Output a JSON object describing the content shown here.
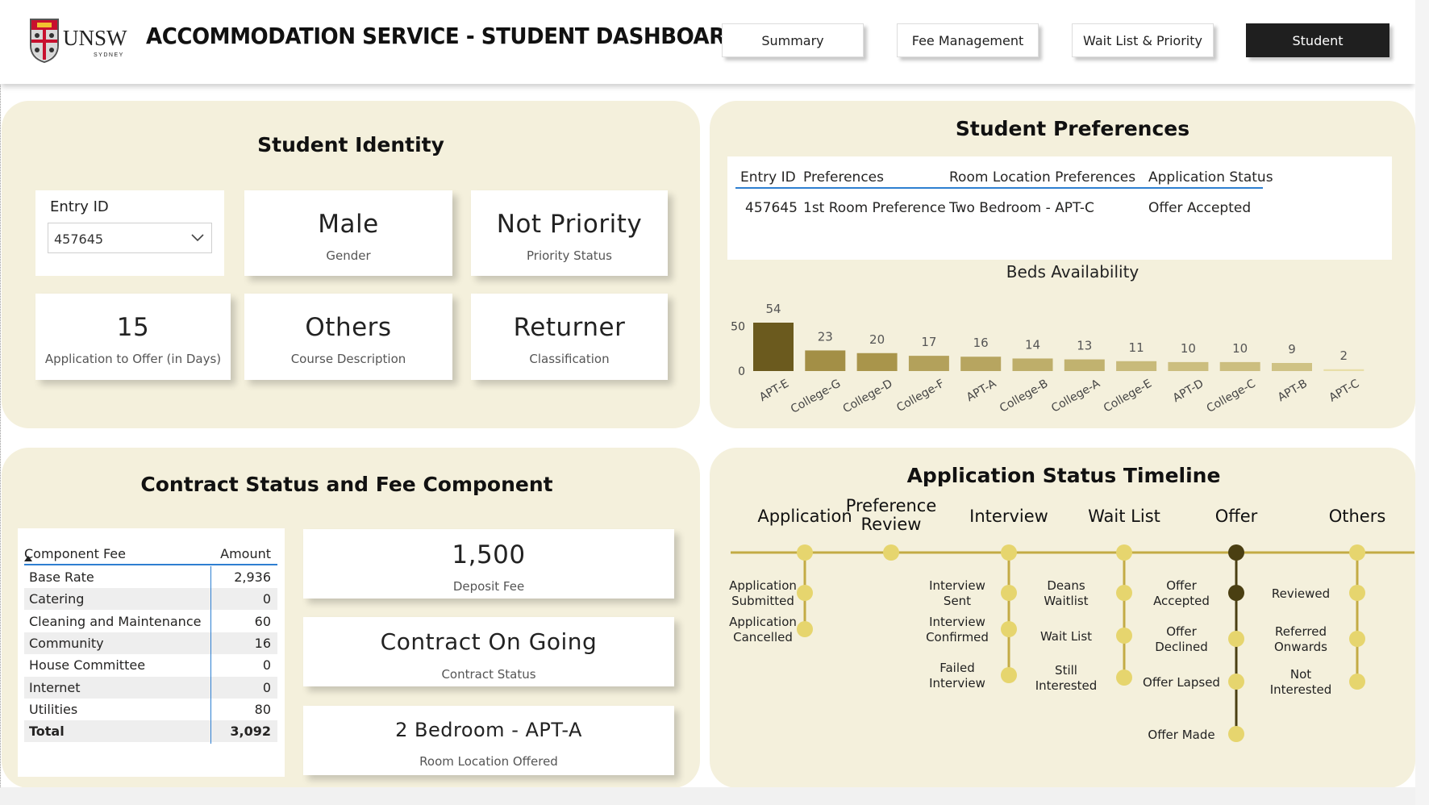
{
  "header": {
    "logo_text": "UNSW",
    "logo_subtext": "SYDNEY",
    "title": "ACCOMMODATION SERVICE - STUDENT DASHBOARD",
    "nav": [
      {
        "label": "Summary",
        "active": false
      },
      {
        "label": "Fee Management",
        "active": false
      },
      {
        "label": "Wait List & Priority",
        "active": false
      },
      {
        "label": "Student",
        "active": true
      }
    ]
  },
  "colors": {
    "panel_bg": "#f4f0dc",
    "accent_blue": "#2e7fd1",
    "timeline_dot": "#e6d56e",
    "timeline_line": "#c3ab45",
    "timeline_active": "#4a3f12",
    "bar_max": "#6b5a1e",
    "bar_mid": "#a8944a",
    "bar_low": "#e8dfa8"
  },
  "identity": {
    "title": "Student Identity",
    "entry_label": "Entry ID",
    "entry_value": "457645",
    "cards": [
      {
        "value": "Male",
        "label": "Gender"
      },
      {
        "value": "Not Priority",
        "label": "Priority Status"
      },
      {
        "value": "15",
        "label": "Application to Offer (in Days)"
      },
      {
        "value": "Others",
        "label": "Course Description"
      },
      {
        "value": "Returner",
        "label": "Classification"
      }
    ]
  },
  "preferences": {
    "title": "Student Preferences",
    "headers": [
      "Entry ID",
      "Preferences",
      "Room Location Preferences",
      "Application Status"
    ],
    "rows": [
      [
        "457645",
        "1st Room Preference",
        "Two Bedroom - APT-C",
        "Offer Accepted"
      ]
    ]
  },
  "chart_data": {
    "type": "bar",
    "title": "Beds Availability",
    "categories": [
      "APT-E",
      "College-G",
      "College-D",
      "College-F",
      "APT-A",
      "College-B",
      "College-A",
      "College-E",
      "APT-D",
      "College-C",
      "APT-B",
      "APT-C"
    ],
    "values": [
      54,
      23,
      20,
      17,
      16,
      14,
      13,
      11,
      10,
      10,
      9,
      2
    ],
    "y_ticks": [
      0,
      50
    ],
    "ylim": [
      0,
      54
    ],
    "grid": false,
    "xlabel": "",
    "ylabel": ""
  },
  "contract": {
    "title": "Contract Status and Fee Component",
    "table_headers": [
      "Component Fee",
      "Amount"
    ],
    "rows": [
      {
        "name": "Base Rate",
        "amount": "2,936"
      },
      {
        "name": "Catering",
        "amount": "0"
      },
      {
        "name": "Cleaning and Maintenance",
        "amount": "60"
      },
      {
        "name": "Community",
        "amount": "16"
      },
      {
        "name": "House Committee",
        "amount": "0"
      },
      {
        "name": "Internet",
        "amount": "0"
      },
      {
        "name": "Utilities",
        "amount": "80"
      }
    ],
    "total": {
      "name": "Total",
      "amount": "3,092"
    },
    "cards": [
      {
        "value": "1,500",
        "label": "Deposit Fee"
      },
      {
        "value": "Contract On Going",
        "label": "Contract Status"
      },
      {
        "value": "2 Bedroom - APT-A",
        "label": "Room Location Offered"
      }
    ]
  },
  "timeline": {
    "title": "Application Status Timeline",
    "stages": [
      {
        "label": "Application",
        "items": [
          "Application Submitted",
          "Application Cancelled"
        ]
      },
      {
        "label": "Preference Review",
        "items": []
      },
      {
        "label": "Interview",
        "items": [
          "Interview Sent",
          "Interview Confirmed",
          "Failed Interview"
        ]
      },
      {
        "label": "Wait List",
        "items": [
          "Deans Waitlist",
          "Wait List",
          "Still Interested"
        ]
      },
      {
        "label": "Offer",
        "items": [
          "Offer Accepted",
          "Offer Declined",
          "Offer Lapsed",
          "Offer Made"
        ],
        "active_stage": true,
        "active_item": "Offer Accepted"
      },
      {
        "label": "Others",
        "items": [
          "Reviewed",
          "Referred Onwards",
          "Not Interested"
        ]
      }
    ]
  }
}
